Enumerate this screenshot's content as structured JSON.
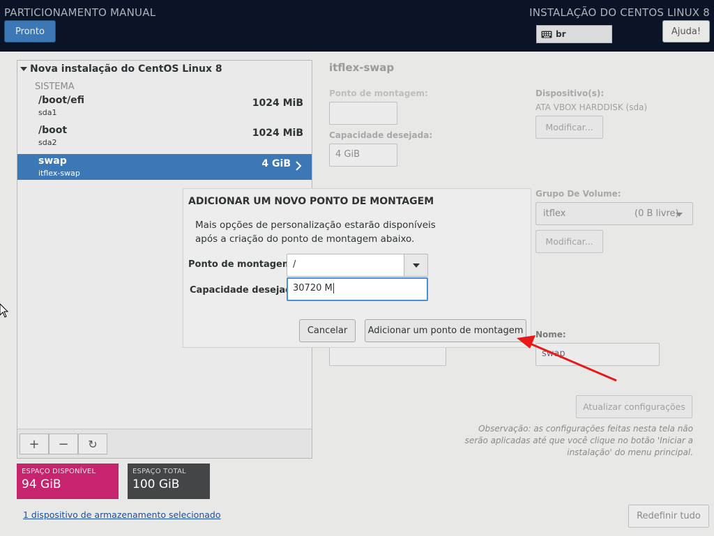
{
  "header": {
    "title": "PARTICIONAMENTO MANUAL",
    "installer_title": "INSTALAÇÃO DO CENTOS LINUX 8",
    "done_label": "Pronto",
    "keyboard_layout": "br",
    "help_label": "Ajuda!"
  },
  "tree": {
    "install_label": "Nova instalação do CentOS Linux 8",
    "section_label": "SISTEMA",
    "partitions": [
      {
        "name": "/boot/efi",
        "device": "sda1",
        "size": "1024 MiB"
      },
      {
        "name": "/boot",
        "device": "sda2",
        "size": "1024 MiB"
      },
      {
        "name": "swap",
        "device": "itflex-swap",
        "size": "4 GiB"
      }
    ],
    "toolbar": {
      "add": "+",
      "remove": "−",
      "refresh": "↻"
    }
  },
  "storage": {
    "available_label": "ESPAÇO DISPONÍVEL",
    "available_value": "94 GiB",
    "total_label": "ESPAÇO TOTAL",
    "total_value": "100 GiB",
    "selected_link": "1 dispositivo de armazenamento selecionado"
  },
  "details": {
    "title": "itflex-swap",
    "mount_point_label": "Ponto de montagem:",
    "mount_point_value": "",
    "desired_capacity_label": "Capacidade desejada:",
    "desired_capacity_value": "4 GiB",
    "devices_label": "Dispositivo(s):",
    "devices_value": "ATA VBOX HARDDISK (sda)",
    "modify_label": "Modificar...",
    "volume_group_label": "Grupo De Volume:",
    "volume_group_name": "itflex",
    "volume_group_free": "(0 B livre)",
    "modify_vg_label": "Modificar...",
    "name_label": "Nome:",
    "name_value": "swap",
    "update_label": "Atualizar configurações",
    "note": "Observação:  as configurações feitas nesta tela não serão aplicadas até que você clique no botão 'Iniciar a instalação' do menu principal.",
    "reset_label": "Redefinir tudo"
  },
  "dialog": {
    "title": "ADICIONAR UM NOVO PONTO DE MONTAGEM",
    "description": "Mais opções de personalização estarão disponíveis após a criação do ponto de montagem abaixo.",
    "mount_point_label": "Ponto de montagem:",
    "mount_point_value": "/",
    "capacity_label": "Capacidade desejada:",
    "capacity_value": "30720 M",
    "cancel_label": "Cancelar",
    "add_label": "Adicionar um ponto de montagem"
  },
  "colors": {
    "header_bg": "#0b1326",
    "accent": "#3b78b5",
    "available_bg": "#c6246e",
    "total_bg": "#434547",
    "annotation_arrow": "#e8191a"
  },
  "icons": {
    "keyboard": "keyboard-icon",
    "expander": "triangle-down-icon",
    "selected_row": "chevron-right-icon",
    "combo": "caret-down-icon",
    "pointer": "mouse-pointer-icon",
    "annotation": "red-arrow-icon"
  }
}
